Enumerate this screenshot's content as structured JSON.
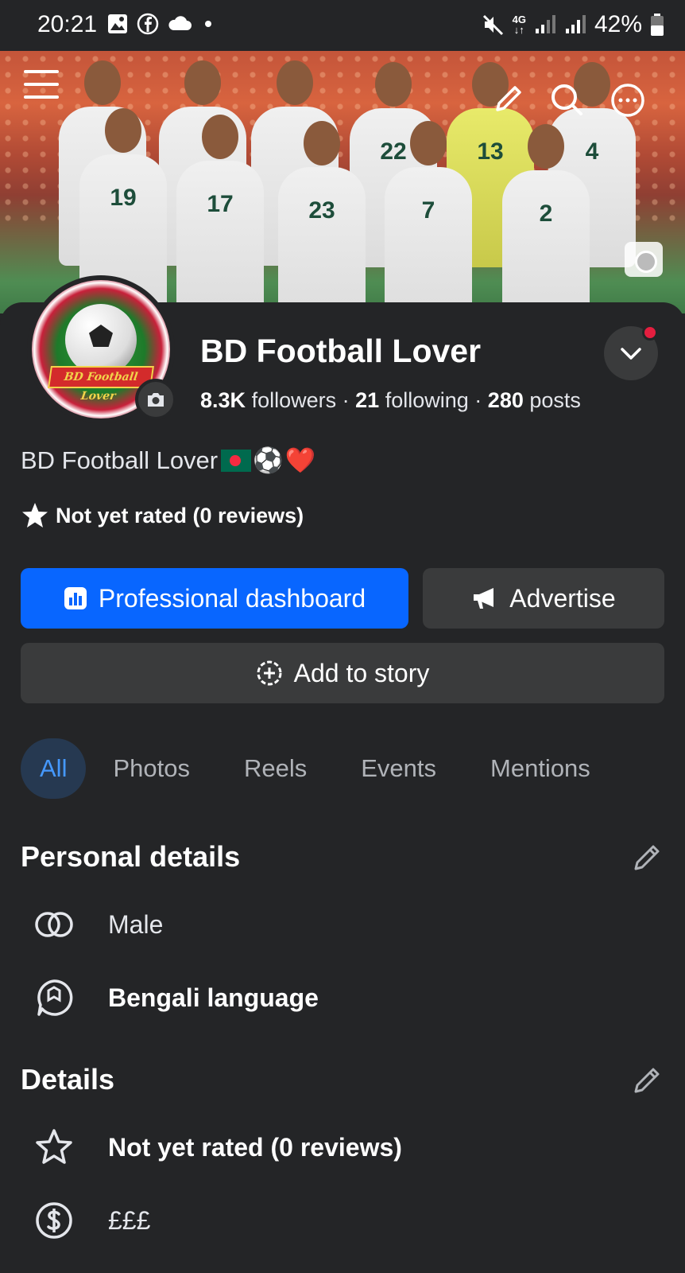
{
  "status_bar": {
    "time": "20:21",
    "network": "4G",
    "battery": "42%",
    "icons_left": [
      "gallery-icon",
      "facebook-icon",
      "cloud-icon",
      "dot-icon"
    ],
    "icons_right": [
      "mute-icon",
      "network-icon",
      "signal-icon",
      "signal-icon",
      "battery-icon"
    ]
  },
  "cover": {
    "jersey_numbers": [
      "19",
      "17",
      "23",
      "7",
      "2",
      "22",
      "13",
      "4"
    ]
  },
  "profile": {
    "name": "BD Football Lover",
    "avatar_text": "BD Football Lover",
    "followers_count": "8.3K",
    "followers_label": "followers",
    "following_count": "21",
    "following_label": "following",
    "posts_count": "280",
    "posts_label": "posts",
    "separator": "·",
    "bio": "BD Football Lover",
    "bio_emojis": [
      "flag-bangladesh",
      "⚽",
      "❤️"
    ],
    "rating": "Not yet rated (0 reviews)"
  },
  "actions": {
    "dashboard_label": "Professional dashboard",
    "advertise_label": "Advertise",
    "story_label": "Add to story"
  },
  "tabs": [
    {
      "label": "All",
      "active": true
    },
    {
      "label": "Photos",
      "active": false
    },
    {
      "label": "Reels",
      "active": false
    },
    {
      "label": "Events",
      "active": false
    },
    {
      "label": "Mentions",
      "active": false
    }
  ],
  "personal_details": {
    "title": "Personal details",
    "gender": "Male",
    "language": "Bengali language"
  },
  "details": {
    "title": "Details",
    "rating": "Not yet rated (0 reviews)",
    "price_range": "£££"
  },
  "colors": {
    "background": "#242527",
    "accent": "#0866ff",
    "active_tab_bg": "#263951",
    "active_tab_text": "#4599ff",
    "notification": "#e41e3f"
  }
}
